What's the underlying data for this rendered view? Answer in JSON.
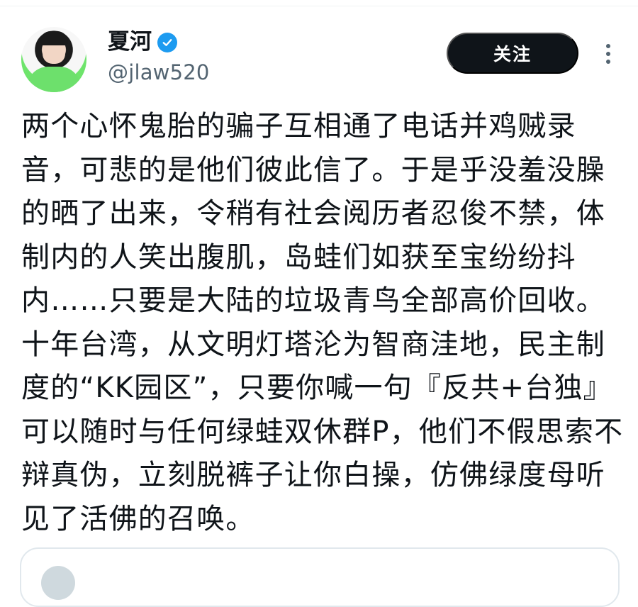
{
  "post": {
    "author": {
      "display_name": "夏河",
      "handle": "@jlaw520",
      "verified_icon": "verified-badge-icon",
      "avatar_icon": "user-avatar"
    },
    "follow_label": "关注",
    "more_icon": "more-vertical-icon",
    "body": "两个心怀鬼胎的骗子互相通了电话并鸡贼录音，可悲的是他们彼此信了。于是乎没羞没臊的晒了出来，令稍有社会阅历者忍俊不禁，体制内的人笑出腹肌，岛蛙们如获至宝纷纷抖内……只要是大陆的垃圾青鸟全部高价回收。十年台湾，从文明灯塔沦为智商洼地，民主制度的“KK园区”，只要你喊一句『反共+台独』可以随时与任何绿蛙双休群P，他们不假思索不辩真伪，立刻脱裤子让你白操，仿佛绿度母听见了活佛的召唤。"
  },
  "colors": {
    "text_primary": "#0f1419",
    "text_secondary": "#536471",
    "verified": "#1d9bf0",
    "button_bg": "#0f1419",
    "button_text": "#ffffff",
    "divider": "#eff3f4"
  }
}
